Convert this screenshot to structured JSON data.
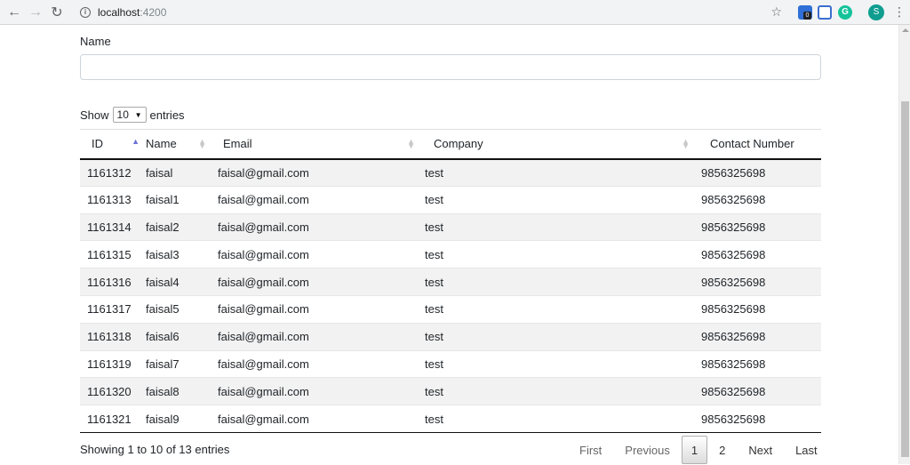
{
  "browser": {
    "url_host": "localhost",
    "url_port": ":4200",
    "ext_badge": "0",
    "ext_grammarly": "G",
    "profile_initial": "S"
  },
  "form": {
    "name_label": "Name",
    "name_value": "",
    "name_placeholder": ""
  },
  "length_control": {
    "show_label": "Show",
    "selected": "10",
    "entries_label": "entries"
  },
  "table": {
    "columns": [
      "ID",
      "Name",
      "Email",
      "Company",
      "Contact Number"
    ],
    "sorted_column": "ID",
    "sort_direction": "ascending",
    "rows": [
      [
        "1161312",
        "faisal",
        "faisal@gmail.com",
        "test",
        "9856325698"
      ],
      [
        "1161313",
        "faisal1",
        "faisal@gmail.com",
        "test",
        "9856325698"
      ],
      [
        "1161314",
        "faisal2",
        "faisal@gmail.com",
        "test",
        "9856325698"
      ],
      [
        "1161315",
        "faisal3",
        "faisal@gmail.com",
        "test",
        "9856325698"
      ],
      [
        "1161316",
        "faisal4",
        "faisal@gmail.com",
        "test",
        "9856325698"
      ],
      [
        "1161317",
        "faisal5",
        "faisal@gmail.com",
        "test",
        "9856325698"
      ],
      [
        "1161318",
        "faisal6",
        "faisal@gmail.com",
        "test",
        "9856325698"
      ],
      [
        "1161319",
        "faisal7",
        "faisal@gmail.com",
        "test",
        "9856325698"
      ],
      [
        "1161320",
        "faisal8",
        "faisal@gmail.com",
        "test",
        "9856325698"
      ],
      [
        "1161321",
        "faisal9",
        "faisal@gmail.com",
        "test",
        "9856325698"
      ]
    ]
  },
  "footer": {
    "info": "Showing 1 to 10 of 13 entries",
    "pagination": {
      "first": "First",
      "previous": "Previous",
      "pages": [
        "1",
        "2"
      ],
      "current_page": "1",
      "next": "Next",
      "last": "Last"
    }
  },
  "colors": {
    "sort_active": "#6b72d6",
    "row_striped": "#f2f2f2",
    "header_border": "#111111"
  }
}
